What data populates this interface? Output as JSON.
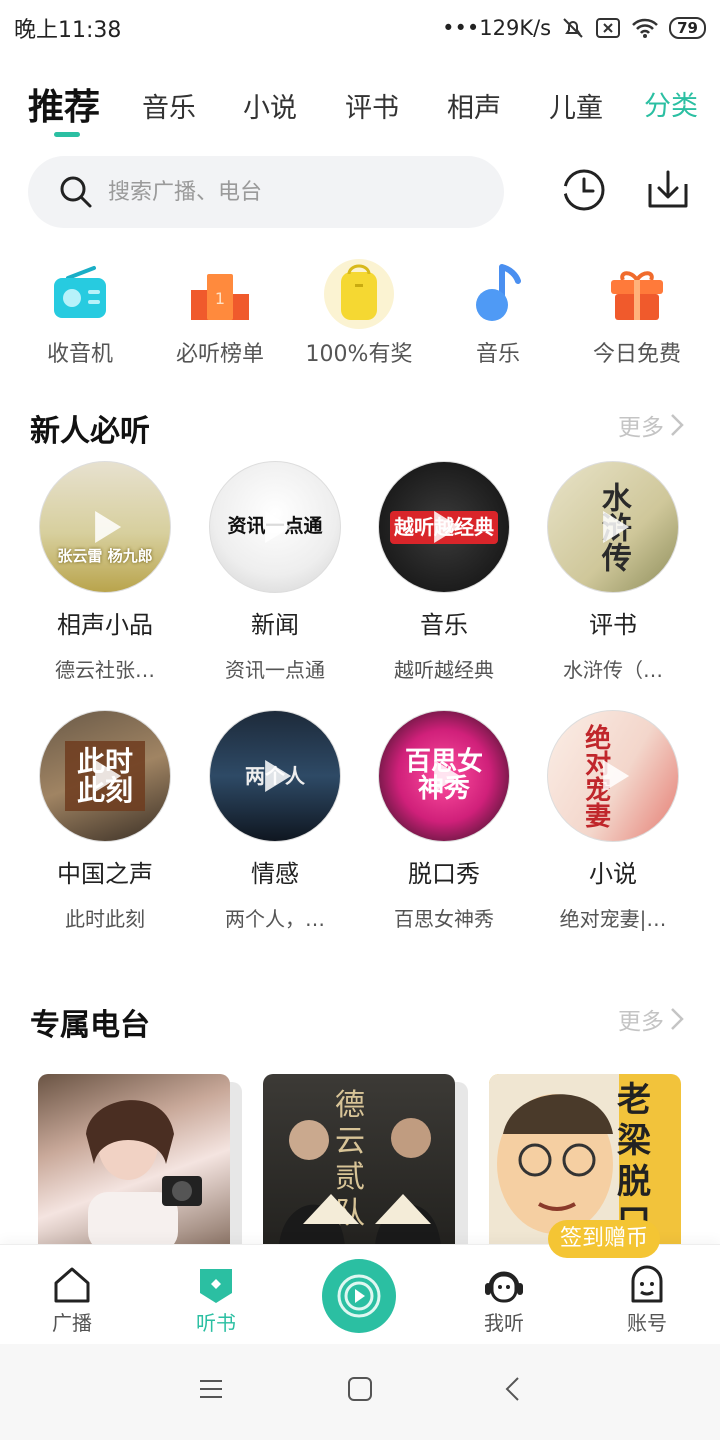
{
  "status_bar": {
    "time": "晚上11:38",
    "network_speed": "•••129K/s",
    "battery": "79"
  },
  "tabs": [
    {
      "label": "推荐",
      "active": true
    },
    {
      "label": "音乐"
    },
    {
      "label": "小说"
    },
    {
      "label": "评书"
    },
    {
      "label": "相声"
    },
    {
      "label": "儿童"
    },
    {
      "label": "分类",
      "accent": true
    }
  ],
  "search": {
    "placeholder": "搜索广播、电台",
    "history_icon": "history-clock-icon",
    "download_icon": "download-icon"
  },
  "quick_entries": [
    {
      "label": "收音机",
      "icon": "radio-icon"
    },
    {
      "label": "必听榜单",
      "icon": "podium-icon"
    },
    {
      "label": "100%有奖",
      "icon": "backpack-prize-icon"
    },
    {
      "label": "音乐",
      "icon": "music-note-icon"
    },
    {
      "label": "今日免费",
      "icon": "gift-icon"
    }
  ],
  "new_user": {
    "title": "新人必听",
    "more": "更多",
    "items": [
      {
        "title": "相声小品",
        "subtitle": "德云社张…",
        "cover_text": "张云雷 杨九郎"
      },
      {
        "title": "新闻",
        "subtitle": "资讯一点通",
        "cover_text": "资讯一点通"
      },
      {
        "title": "音乐",
        "subtitle": "越听越经典",
        "cover_text": "越听越经典"
      },
      {
        "title": "评书",
        "subtitle": "水浒传（…",
        "cover_text": "水浒传"
      },
      {
        "title": "中国之声",
        "subtitle": "此时此刻",
        "cover_text": "此时此刻"
      },
      {
        "title": "情感",
        "subtitle": "两个人，…",
        "cover_text": "两个人"
      },
      {
        "title": "脱口秀",
        "subtitle": "百思女神秀",
        "cover_text": "百思女神秀"
      },
      {
        "title": "小说",
        "subtitle": "绝对宠妻|…",
        "cover_text": "绝对宠妻"
      }
    ]
  },
  "stations": {
    "title": "专属电台",
    "more": "更多",
    "cards": [
      {
        "cover_text": ""
      },
      {
        "cover_text": "德云 贰 队"
      },
      {
        "cover_text": "老梁 脱口大"
      }
    ],
    "checkin_label": "签到赠币"
  },
  "bottom_nav": [
    {
      "label": "广播",
      "icon": "home-icon"
    },
    {
      "label": "听书",
      "icon": "book-icon",
      "active": true
    },
    {
      "label": "",
      "icon": "play-disc-icon"
    },
    {
      "label": "我听",
      "icon": "headphone-face-icon"
    },
    {
      "label": "账号",
      "icon": "account-face-icon"
    }
  ],
  "colors": {
    "accent": "#2bbfa2",
    "checkin": "#f4c534"
  }
}
